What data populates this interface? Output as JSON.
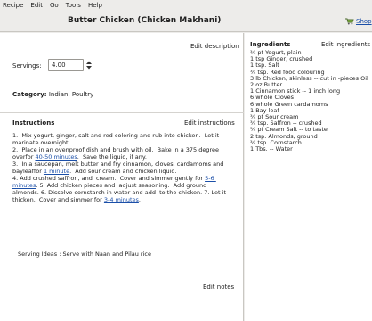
{
  "menu": [
    {
      "label": "Recipe",
      "mnemonic": "R"
    },
    {
      "label": "Edit",
      "mnemonic": "E"
    },
    {
      "label": "Go",
      "mnemonic": "G"
    },
    {
      "label": "Tools",
      "mnemonic": "T"
    },
    {
      "label": "Help",
      "mnemonic": "H"
    }
  ],
  "header": {
    "title": "Butter Chicken (Chicken Makhani)",
    "shop_label": "Shop"
  },
  "left": {
    "edit_description": "Edit description",
    "servings_label": "Servings:",
    "servings_value": "4.00",
    "category_label": "Category:",
    "category_value": "Indian, Poultry",
    "instructions_label": "Instructions",
    "edit_instructions": "Edit instructions",
    "serving_ideas": "Serving Ideas : Serve with Naan and Pilau rice",
    "edit_notes": "Edit notes"
  },
  "instructions": {
    "parts": [
      "1.  Mix yogurt, ginger, salt and red coloring and rub into chicken.  Let it marinate overnight.\n2.  Place in an ovenproof dish and brush with oil.  Bake in a 375 degree overfor ",
      "40-50 minutes",
      ".  Save the liquid, if any.\n3.  In a saucepan, melt butter and fry cinnamon, cloves, cardamoms and bayleaffor ",
      "1 minute",
      ".  Add sour cream and chicken liquid.\n4. Add crushed saffron, and  cream.  Cover and simmer gently for ",
      "5-6 minutes",
      ". 5. Add chicken pieces and  adjust seasoning.  Add ground almonds. 6. Dissolve cornstarch in water and add  to the chicken. 7. Let it thicken.  Cover and simmer for ",
      "3-4 minutes",
      "."
    ]
  },
  "ingredients": {
    "label": "Ingredients",
    "edit_label": "Edit ingredients",
    "items": [
      "¾ pt Yogurt, plain",
      "1 tsp Ginger, crushed",
      "1 tsp. Salt",
      "¾ tsp. Red food colouring",
      "3 lb Chicken, skinless -- cut in -pieces Oil",
      "2 oz Butter",
      "1 Cinnamon stick -- 1 inch long",
      "6 whole Cloves",
      "6 whole Green cardamoms",
      "1 Bay leaf",
      "¾ pt Sour cream",
      "¾ tsp. Saffron -- crushed",
      "¾ pt Cream Salt -- to taste",
      "2 tsp. Almonds, ground",
      "¾ tsp. Cornstarch",
      "1 Tbs. -- Water"
    ]
  },
  "colors": {
    "link": "#1b4fa8",
    "chrome": "#edecea",
    "pane": "#ffffff"
  }
}
